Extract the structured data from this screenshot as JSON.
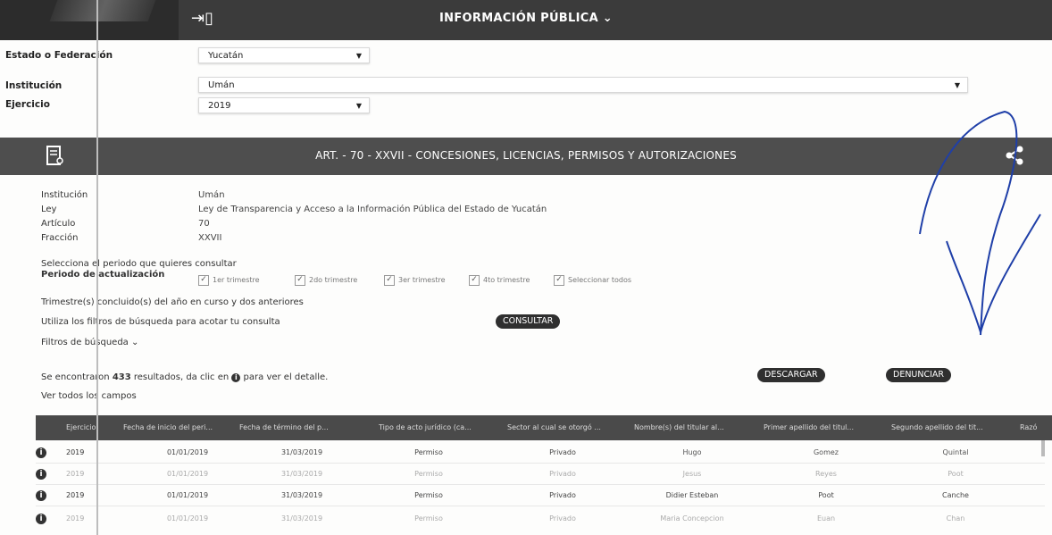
{
  "header": {
    "nav_title": "INFORMACIÓN PÚBLICA ⌄",
    "exit_icon": "exit-icon"
  },
  "filters": {
    "estado_label": "Estado o Federación",
    "estado_value": "Yucatán",
    "institucion_label": "Institución",
    "institucion_value": "Umán",
    "ejercicio_label": "Ejercicio",
    "ejercicio_value": "2019"
  },
  "article": {
    "title": "ART. - 70 - XXVII - CONCESIONES, LICENCIAS, PERMISOS Y AUTORIZACIONES"
  },
  "details": [
    {
      "label": "Institución",
      "value": "Umán"
    },
    {
      "label": "Ley",
      "value": "Ley de Transparencia y Acceso a la Información Pública del Estado de Yucatán"
    },
    {
      "label": "Artículo",
      "value": "70"
    },
    {
      "label": "Fracción",
      "value": "XXVII"
    }
  ],
  "period": {
    "select_text": "Selecciona el periodo que quieres consultar",
    "label": "Periodo de actualización",
    "options": [
      "1er trimestre",
      "2do trimestre",
      "3er trimestre",
      "4to trimestre",
      "Seleccionar todos"
    ],
    "note": "Trimestre(s) concluido(s) del año en curso y dos anteriores"
  },
  "search": {
    "hint": "Utiliza los filtros de búsqueda para acotar tu consulta",
    "consult_button": "CONSULTAR",
    "filters_label": "Filtros de búsqueda ⌄"
  },
  "results": {
    "summary_prefix": "Se encontraron ",
    "count": "433",
    "summary_suffix": " resultados, da clic en ",
    "summary_end": " para ver el detalle.",
    "view_all": "Ver todos los campos",
    "download_button": "DESCARGAR",
    "report_button": "DENUNCIAR"
  },
  "table": {
    "headers": [
      "Ejercicio",
      "Fecha de inicio del peri...",
      "Fecha de término del p...",
      "Tipo de acto jurídico (ca...",
      "Sector al cual se otorgó ...",
      "Nombre(s) del titular al...",
      "Primer apellido del titul...",
      "Segundo apellido del tit...",
      "Razó"
    ],
    "rows": [
      [
        "2019",
        "01/01/2019",
        "31/03/2019",
        "Permiso",
        "Privado",
        "Hugo",
        "Gomez",
        "Quintal"
      ],
      [
        "2019",
        "01/01/2019",
        "31/03/2019",
        "Permiso",
        "Privado",
        "Jesus",
        "Reyes",
        "Poot"
      ],
      [
        "2019",
        "01/01/2019",
        "31/03/2019",
        "Permiso",
        "Privado",
        "Didier Esteban",
        "Poot",
        "Canche"
      ],
      [
        "2019",
        "01/01/2019",
        "31/03/2019",
        "Permiso",
        "Privado",
        "Maria Concepcion",
        "Euan",
        "Chan"
      ]
    ]
  }
}
